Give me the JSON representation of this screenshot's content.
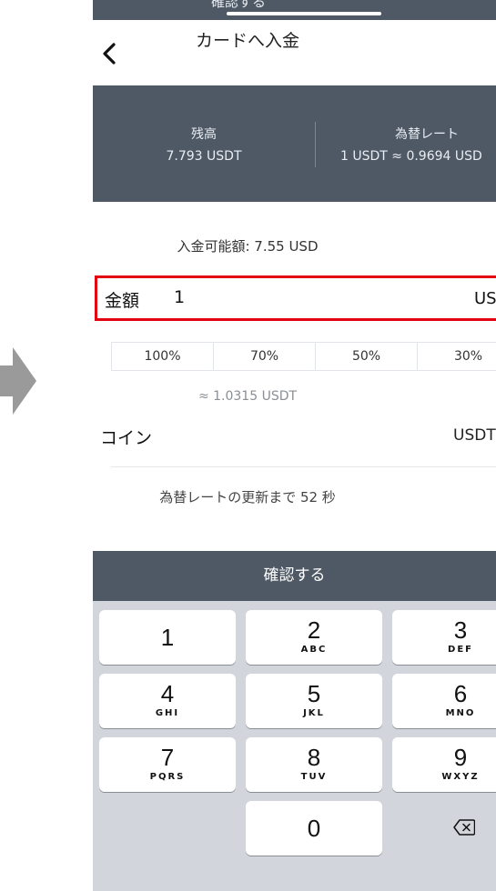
{
  "previous_screen": {
    "confirm_label": "確認する"
  },
  "header": {
    "title": "カードへ入金"
  },
  "info": {
    "balance_label": "残高",
    "balance_value": "7.793 USDT",
    "rate_label": "為替レート",
    "rate_value": "1 USDT ≈ 0.9694 USD"
  },
  "available": "入金可能額: 7.55 USD",
  "amount": {
    "label": "金額",
    "value": "1",
    "unit": "USD"
  },
  "percent_options": [
    "100%",
    "70%",
    "50%",
    "30%"
  ],
  "approx": "≈ 1.0315 USDT",
  "coin": {
    "label": "コイン",
    "value": "USDT"
  },
  "countdown": "為替レートの更新まで 52 秒",
  "confirm_label": "確認する",
  "keypad": {
    "keys": [
      {
        "num": "1",
        "letters": ""
      },
      {
        "num": "2",
        "letters": "ABC"
      },
      {
        "num": "3",
        "letters": "DEF"
      },
      {
        "num": "4",
        "letters": "GHI"
      },
      {
        "num": "5",
        "letters": "JKL"
      },
      {
        "num": "6",
        "letters": "MNO"
      },
      {
        "num": "7",
        "letters": "PQRS"
      },
      {
        "num": "8",
        "letters": "TUV"
      },
      {
        "num": "9",
        "letters": "WXYZ"
      },
      {
        "num": "0",
        "letters": ""
      }
    ],
    "delete_icon": "backspace-icon"
  },
  "colors": {
    "panel": "#4f5966",
    "highlight": "#e3000f",
    "keypad_bg": "#d2d5db",
    "arrow": "#9a9a9a"
  }
}
